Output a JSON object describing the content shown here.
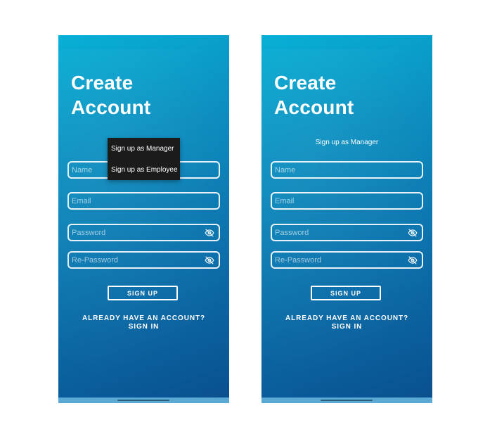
{
  "screens": [
    {
      "title_line1": "Create",
      "title_line2": "Account",
      "fields": {
        "name_placeholder": "Name",
        "email_placeholder": "Email",
        "password_placeholder": "Password",
        "repassword_placeholder": "Re-Password"
      },
      "signup_label": "SIGN UP",
      "signin_line1": "ALREADY HAVE AN ACCOUNT?",
      "signin_line2": "SIGN IN",
      "menu": {
        "items": [
          {
            "label": "Sign up as Manager"
          },
          {
            "label": "Sign up as Employee"
          }
        ]
      }
    },
    {
      "title_line1": "Create",
      "title_line2": "Account",
      "role_label": "Sign up as Manager",
      "fields": {
        "name_placeholder": "Name",
        "email_placeholder": "Email",
        "password_placeholder": "Password",
        "repassword_placeholder": "Re-Password"
      },
      "signup_label": "SIGN UP",
      "signin_line1": "ALREADY HAVE AN ACCOUNT?",
      "signin_line2": "SIGN IN"
    }
  ],
  "icons": {
    "password_toggle": "eye-off-icon"
  },
  "colors": {
    "gradient_top": "#08b0d6",
    "gradient_bottom": "#0a4f8e",
    "menu_background": "#1b1b1b",
    "text": "#ffffff"
  }
}
